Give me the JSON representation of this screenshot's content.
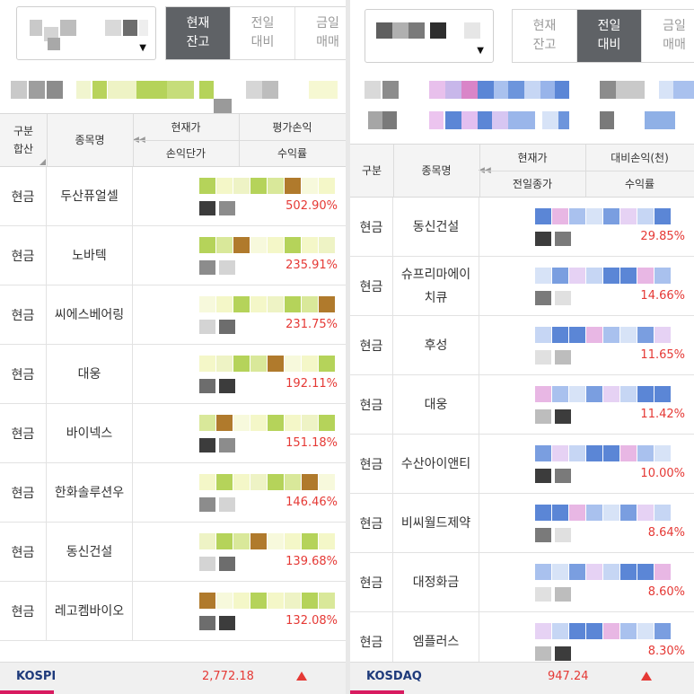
{
  "left": {
    "tabs": [
      {
        "label": "현재\n잔고",
        "active": true
      },
      {
        "label": "전일\n대비",
        "active": false
      },
      {
        "label": "금일\n매매",
        "active": false
      }
    ],
    "header": {
      "col_type": "구분\n합산",
      "col_name": "종목명",
      "col_price": "현재가",
      "col_pnl": "평가손익",
      "col_cost": "손익단가",
      "col_rate": "수익률"
    },
    "rows": [
      {
        "type": "현금",
        "name": "두산퓨얼셀",
        "rate": "502.90%"
      },
      {
        "type": "현금",
        "name": "노바텍",
        "rate": "235.91%"
      },
      {
        "type": "현금",
        "name": "씨에스베어링",
        "rate": "231.75%"
      },
      {
        "type": "현금",
        "name": "대웅",
        "rate": "192.11%"
      },
      {
        "type": "현금",
        "name": "바이넥스",
        "rate": "151.18%"
      },
      {
        "type": "현금",
        "name": "한화솔루션우",
        "rate": "146.46%"
      },
      {
        "type": "현금",
        "name": "동신건설",
        "rate": "139.68%"
      },
      {
        "type": "현금",
        "name": "레고켐바이오",
        "rate": "132.08%"
      }
    ],
    "footer": {
      "index_name": "KOSPI",
      "index_value": "2,772.18"
    }
  },
  "right": {
    "tabs": [
      {
        "label": "현재\n잔고",
        "active": false
      },
      {
        "label": "전일\n대비",
        "active": true
      },
      {
        "label": "금일\n매매",
        "active": false
      }
    ],
    "header": {
      "col_type": "구분",
      "col_name": "종목명",
      "col_price": "현재가",
      "col_pnl": "대비손익(천)",
      "col_prev": "전일종가",
      "col_rate": "수익률"
    },
    "rows": [
      {
        "type": "현금",
        "name": "동신건설",
        "rate": "29.85%"
      },
      {
        "type": "현금",
        "name": "슈프리마에이\n치큐",
        "rate": "14.66%"
      },
      {
        "type": "현금",
        "name": "후성",
        "rate": "11.65%"
      },
      {
        "type": "현금",
        "name": "대웅",
        "rate": "11.42%"
      },
      {
        "type": "현금",
        "name": "수산아이앤티",
        "rate": "10.00%"
      },
      {
        "type": "현금",
        "name": "비씨월드제약",
        "rate": "8.64%"
      },
      {
        "type": "현금",
        "name": "대정화금",
        "rate": "8.60%"
      },
      {
        "type": "현금",
        "name": "엠플러스",
        "rate": "8.30%"
      }
    ],
    "footer": {
      "index_name": "KOSDAQ",
      "index_value": "947.24"
    }
  },
  "colors": {
    "accent_up": "#e53935",
    "tab_active_bg": "#5f6266",
    "footer_index_name": "#1e3a7b",
    "footer_bar": "#d81b60",
    "blur_green": "#b5d35a",
    "blur_yellow": "#f4f7c8",
    "blur_blue": "#5b86d6",
    "blur_pink": "#e8b7e4",
    "blur_brown": "#b07a2c",
    "blur_dark": "#3c3c3c"
  },
  "icons": {
    "dropdown": "caret-down-icon",
    "collapse": "double-chevron-left-icon",
    "index_up": "triangle-up-icon"
  }
}
